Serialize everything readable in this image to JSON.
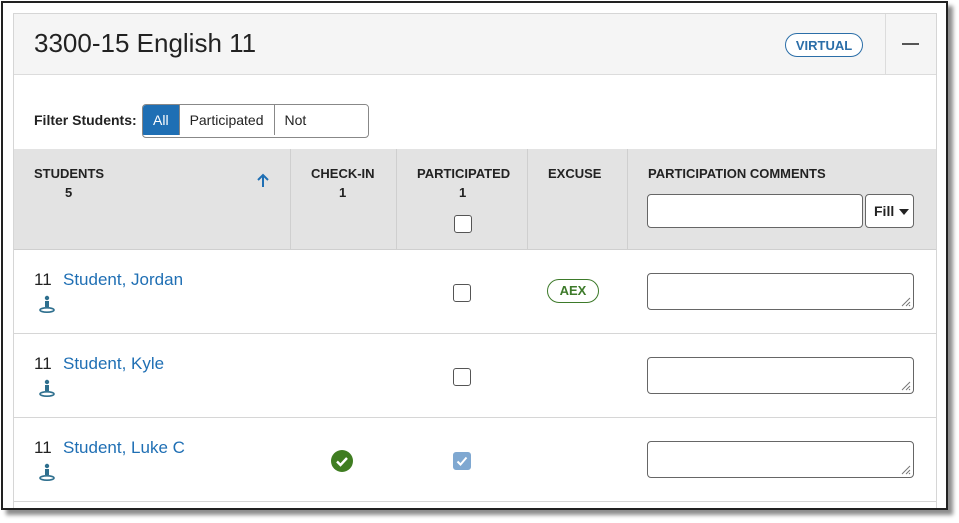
{
  "section": {
    "title": "3300-15 English 11",
    "badge": "VIRTUAL",
    "collapse_icon": "minus-icon"
  },
  "filter": {
    "label": "Filter Students:",
    "options": [
      "All",
      "Participated",
      "Not Participated"
    ],
    "selected": "All"
  },
  "table": {
    "columns": {
      "students": {
        "label": "STUDENTS",
        "count": "5"
      },
      "checkin": {
        "label": "CHECK-IN",
        "count": "1"
      },
      "participated": {
        "label": "PARTICIPATED",
        "count": "1"
      },
      "excuse": {
        "label": "EXCUSE"
      },
      "comments": {
        "label": "PARTICIPATION COMMENTS",
        "fill_label": "Fill"
      }
    },
    "rows": [
      {
        "grade": "11",
        "name": "Student, Jordan",
        "checked_in": false,
        "participated": false,
        "excuse": "AEX"
      },
      {
        "grade": "11",
        "name": "Student, Kyle",
        "checked_in": false,
        "participated": false,
        "excuse": ""
      },
      {
        "grade": "11",
        "name": "Student, Luke C",
        "checked_in": true,
        "participated": true,
        "excuse": ""
      }
    ]
  },
  "colors": {
    "accent": "#1f6fb4",
    "excuse_green": "#3d7a2a",
    "checkin_green": "#3f7d21",
    "checkbox_checked": "#7fa8d1"
  }
}
